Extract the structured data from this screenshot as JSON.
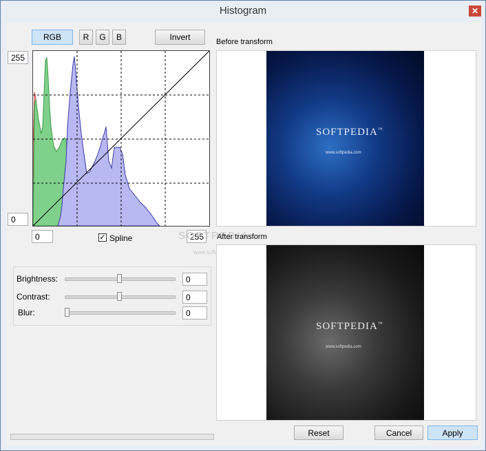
{
  "window": {
    "title": "Histogram"
  },
  "channel_buttons": {
    "rgb": "RGB",
    "r": "R",
    "g": "G",
    "b": "B",
    "invert": "Invert"
  },
  "histogram": {
    "max_label": "255",
    "min_label": "0",
    "input_min": "0",
    "input_max": "255",
    "spline_label": "Spline",
    "spline_checked": true
  },
  "adjustments": {
    "brightness": {
      "label": "Brightness:",
      "value": "0",
      "level": 0.5
    },
    "contrast": {
      "label": "Contrast:",
      "value": "0",
      "level": 0.5
    },
    "blur": {
      "label": "Blur:",
      "value": "0",
      "level": 0.0
    }
  },
  "previews": {
    "before_label": "Before transform",
    "after_label": "After transform",
    "image_text": "SOFTPEDIA",
    "image_tm": "™",
    "image_url_text": "www.softpedia.com",
    "watermark": "SOFTPEDIA",
    "watermark_url": "www.softpedia.com"
  },
  "progress": {
    "fraction": 0.0
  },
  "footer": {
    "reset": "Reset",
    "cancel": "Cancel",
    "apply": "Apply"
  },
  "colors": {
    "red_fill": "#f4b6b6",
    "green_fill": "#7fd08a",
    "blue_fill": "#b8b8f3"
  }
}
